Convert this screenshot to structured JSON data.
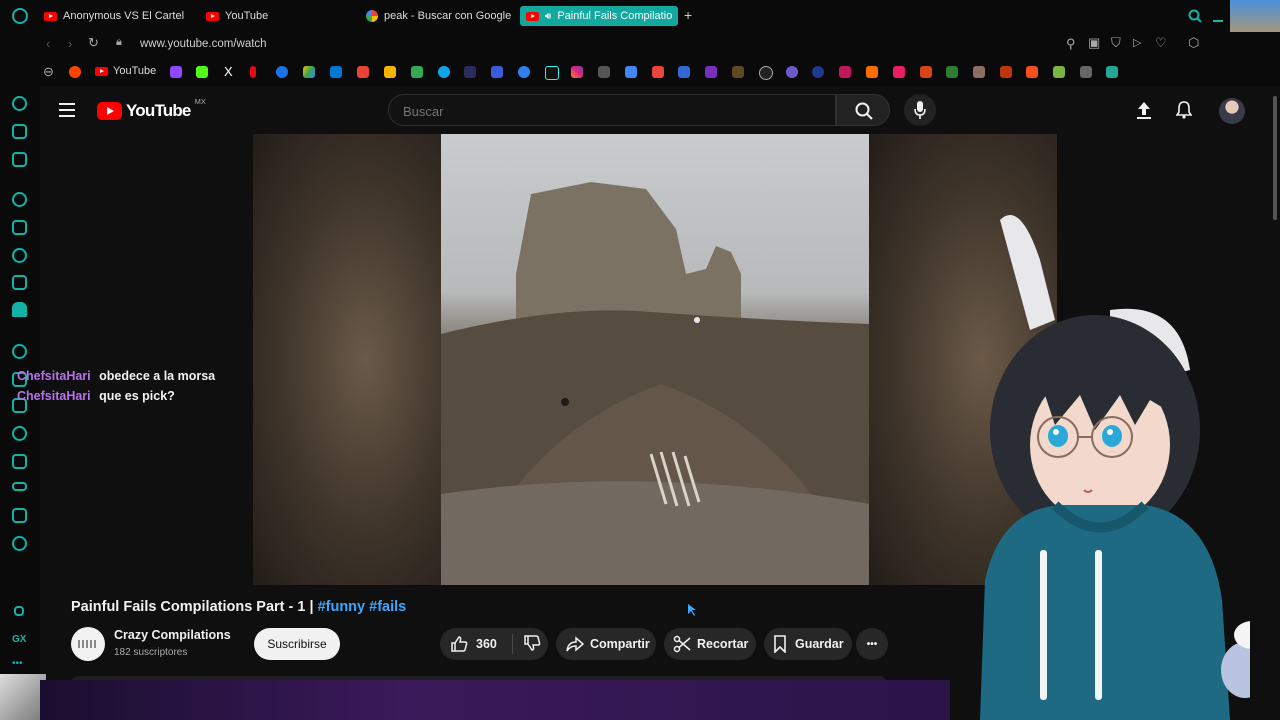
{
  "browser": {
    "tabs": [
      {
        "title": "Anonymous VS El Cartel M",
        "favicon": "youtube-favicon"
      },
      {
        "title": "YouTube",
        "favicon": "youtube-favicon"
      },
      {
        "title": "peak - Buscar con Google",
        "favicon": "google-favicon"
      },
      {
        "title": "Painful Fails Compilatio",
        "favicon": "youtube-favicon",
        "active": true
      }
    ],
    "new_tab_glyph": "+",
    "url": "www.youtube.com/watch",
    "bookmarks": [
      {
        "label": "YouTube",
        "color": "#ff0000"
      },
      {
        "label": "X",
        "color": "#ffffff"
      }
    ]
  },
  "youtube": {
    "logo_text": "YouTube",
    "region_badge": "MX",
    "search_placeholder": "Buscar"
  },
  "chat": [
    {
      "name": "ChefsitaHari",
      "message": "obedece a la morsa"
    },
    {
      "name": "ChefsitaHari",
      "message": "que es pick?"
    }
  ],
  "video": {
    "title_text": "Painful Fails Compilations Part - 1 | ",
    "hashtags": "#funny #fails",
    "channel_name": "Crazy Compilations",
    "subscribers": "182 suscriptores",
    "subscribe_label": "Suscribirse",
    "likes": "360",
    "share_label": "Compartir",
    "clip_label": "Recortar",
    "save_label": "Guardar",
    "more_glyph": "•••"
  },
  "colors": {
    "accent_tab": "#13a89e",
    "chat_name": "#b673e8",
    "hashtag": "#3ea6ff",
    "dock_icon": "#12b4a7"
  }
}
